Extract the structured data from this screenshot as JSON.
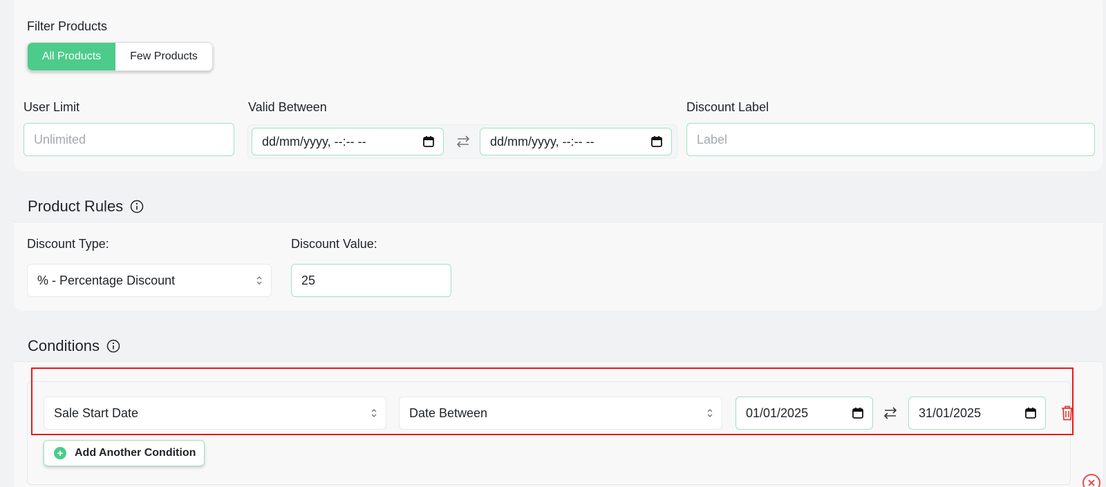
{
  "filter": {
    "label": "Filter Products",
    "options": [
      "All Products",
      "Few Products"
    ],
    "selected": "All Products"
  },
  "user_limit": {
    "label": "User Limit",
    "placeholder": "Unlimited"
  },
  "valid_between": {
    "label": "Valid Between",
    "start_value": "dd/mm/yyyy, --:-- --",
    "end_value": "dd/mm/yyyy, --:-- --"
  },
  "discount_label": {
    "label": "Discount Label",
    "placeholder": "Label"
  },
  "product_rules": {
    "title": "Product Rules",
    "discount_type": {
      "label": "Discount Type:",
      "value": "% - Percentage Discount"
    },
    "discount_value": {
      "label": "Discount Value:",
      "value": "25"
    }
  },
  "conditions": {
    "title": "Conditions",
    "row": {
      "field": "Sale Start Date",
      "operator": "Date Between",
      "from": "01/01/2025",
      "to": "31/01/2025"
    },
    "add_label": "Add Another Condition"
  },
  "colors": {
    "accent": "#4ccb8a",
    "highlight": "#f01616",
    "danger": "#f04848"
  },
  "icons": [
    "info-icon",
    "calendar-icon",
    "swap-icon",
    "updown-icon",
    "trash-icon",
    "plus-icon",
    "close-icon"
  ]
}
